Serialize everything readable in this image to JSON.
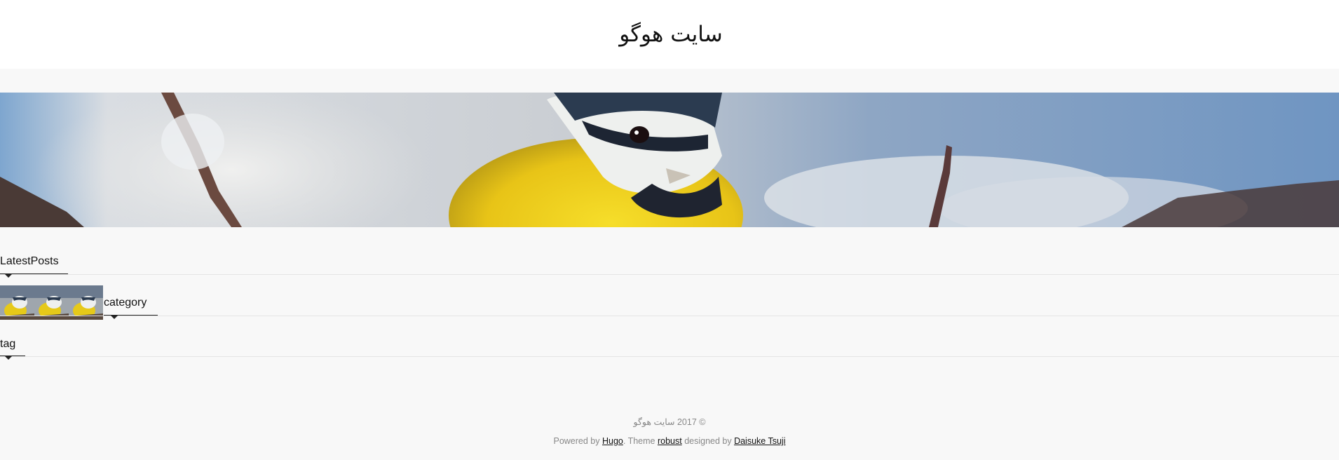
{
  "site": {
    "title": "سایت هوگو"
  },
  "hero": {
    "image": "bird-blue-tit-banner"
  },
  "sections": {
    "latest_posts": "LatestPosts",
    "category": "category",
    "tag": "tag"
  },
  "thumbnails": [
    {
      "image": "bird-thumbnail"
    },
    {
      "image": "bird-thumbnail"
    },
    {
      "image": "bird-thumbnail"
    }
  ],
  "footer": {
    "copyright": "© 2017 سایت هوگو",
    "powered_by": "Powered by ",
    "hugo_link": "Hugo",
    "theme_prefix": ". Theme ",
    "theme_link": "robust",
    "designed_by": " designed by ",
    "author_link": "Daisuke Tsuji"
  },
  "colors": {
    "header_bg": "#ffffff",
    "page_bg": "#f8f8f8",
    "footer_text": "#888888",
    "accent_yellow": "#f2d21a"
  }
}
